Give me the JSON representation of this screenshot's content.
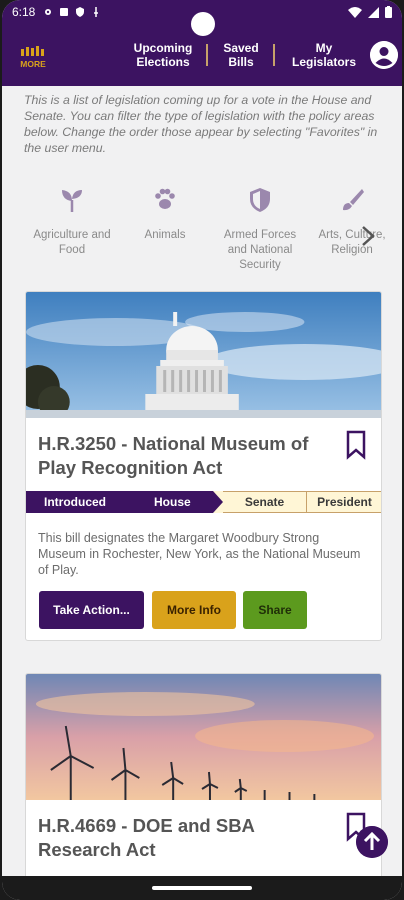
{
  "status_bar": {
    "time": "6:18"
  },
  "nav": {
    "upcoming_line1": "Upcoming",
    "upcoming_line2": "Elections",
    "saved_line1": "Saved",
    "saved_line2": "Bills",
    "legislators_line1": "My",
    "legislators_line2": "Legislators",
    "logo_text": "MORE"
  },
  "intro_text": "This is a list of legislation coming up for a vote in the House and Senate. You can filter the type of legislation with the policy areas below. Change the order those appear by selecting \"Favorites\" in the user menu.",
  "policy_areas": [
    {
      "label_line1": "Agriculture and",
      "label_line2": "Food",
      "label_line3": "",
      "icon": "sprout-icon"
    },
    {
      "label_line1": "Animals",
      "label_line2": "",
      "label_line3": "",
      "icon": "paw-icon"
    },
    {
      "label_line1": "Armed Forces",
      "label_line2": "and National",
      "label_line3": "Security",
      "icon": "shield-icon"
    },
    {
      "label_line1": "Arts, Culture,",
      "label_line2": "Religion",
      "label_line3": "",
      "icon": "brush-icon"
    }
  ],
  "bills": [
    {
      "title": "H.R.3250 - National Museum of Play Recognition Act",
      "stages": [
        "Introduced",
        "House",
        "Senate",
        "President"
      ],
      "description": "This bill designates the Margaret Woodbury Strong Museum in Rochester, New York, as the National Museum of Play.",
      "buttons": {
        "take_action": "Take Action...",
        "more_info": "More Info",
        "share": "Share"
      }
    },
    {
      "title": "H.R.4669 - DOE and SBA Research Act"
    }
  ],
  "colors": {
    "brand_purple": "#3c1361",
    "accent_gold": "#d9a21b",
    "share_green": "#5c9a1e",
    "stage_pending": "#fff6d6"
  }
}
